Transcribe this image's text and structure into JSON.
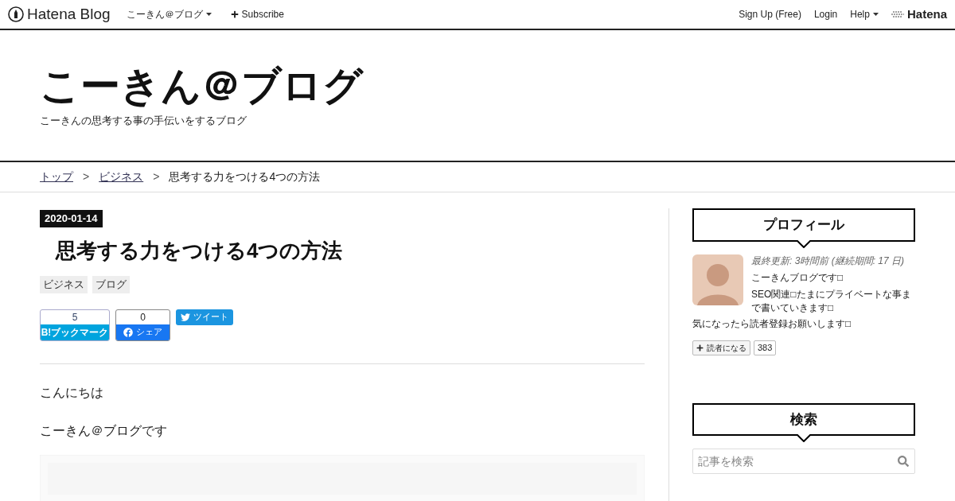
{
  "topbar": {
    "logo": "Hatena Blog",
    "blog_menu": "こーきん＠ブログ",
    "subscribe": "Subscribe",
    "signup": "Sign Up (Free)",
    "login": "Login",
    "help": "Help",
    "hatena": "Hatena"
  },
  "header": {
    "title": "こーきん＠ブログ",
    "description": "こーきんの思考する事の手伝いをするブログ"
  },
  "breadcrumb": [
    {
      "label": "トップ",
      "link": true
    },
    {
      "label": "ビジネス",
      "link": true
    },
    {
      "label": "思考する力をつける4つの方法",
      "link": false
    }
  ],
  "breadcrumb_separator": ">",
  "article": {
    "date": "2020-01-14",
    "title": "思考する力をつける4つの方法",
    "categories": [
      "ビジネス",
      "ブログ"
    ],
    "share": {
      "bookmark_count": "5",
      "bookmark_label": "B!ブックマーク",
      "facebook_count": "0",
      "facebook_label": "シェア",
      "tweet_label": "ツイート"
    },
    "paragraphs": [
      "こんにちは",
      "こーきん＠ブログです"
    ],
    "image": {
      "kind": "picture"
    }
  },
  "sidebar": {
    "profile": {
      "heading": "プロフィール",
      "updated": "最終更新: 3時間前 (継続期間: 17 日)",
      "bio_lines": [
        "こーきんブログです□",
        "SEO関連□たまにプライベートな事まで書いていきます□"
      ],
      "bio_last": "気になったら読者登録お願いします□",
      "subscribe_label": "読者になる",
      "subscriber_count": "383"
    },
    "search": {
      "heading": "検索",
      "placeholder": "記事を検索"
    }
  }
}
